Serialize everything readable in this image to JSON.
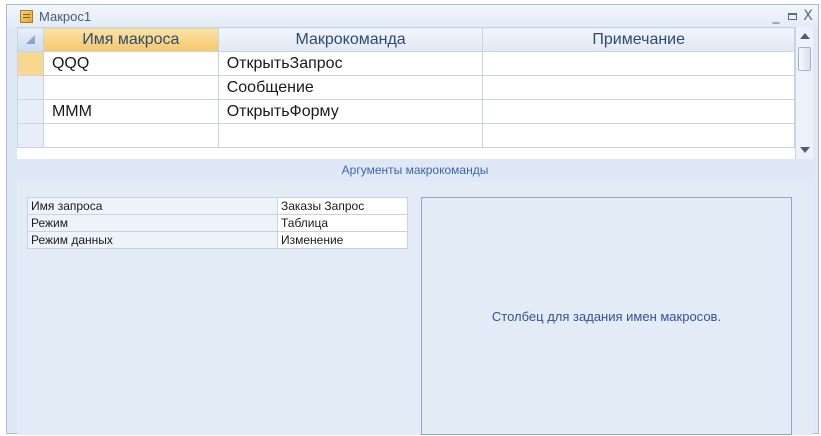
{
  "window": {
    "title": "Макрос1",
    "controls": {
      "minimize": "_",
      "close": "X"
    }
  },
  "grid": {
    "columns": [
      {
        "label": "Имя макроса"
      },
      {
        "label": "Макрокоманда"
      },
      {
        "label": "Примечание"
      }
    ],
    "rows": [
      {
        "name": "QQQ",
        "action": "ОткрытьЗапрос",
        "note": ""
      },
      {
        "name": "",
        "action": "Сообщение",
        "note": ""
      },
      {
        "name": "MMM",
        "action": "ОткрытьФорму",
        "note": ""
      }
    ]
  },
  "args": {
    "header": "Аргументы макрокоманды",
    "items": [
      {
        "name": "Имя запроса",
        "value": "Заказы Запрос"
      },
      {
        "name": "Режим",
        "value": "Таблица"
      },
      {
        "name": "Режим данных",
        "value": "Изменение"
      }
    ],
    "help_text": "Столбец для задания имен макросов."
  },
  "icons": {
    "app": "macro-icon",
    "minimize": "minimize-icon",
    "maximize": "maximize-icon",
    "close": "close-icon"
  },
  "colors": {
    "active_header": "#f5c76a",
    "panel_background": "#e3ebf7",
    "header_text": "#2f4b73"
  }
}
